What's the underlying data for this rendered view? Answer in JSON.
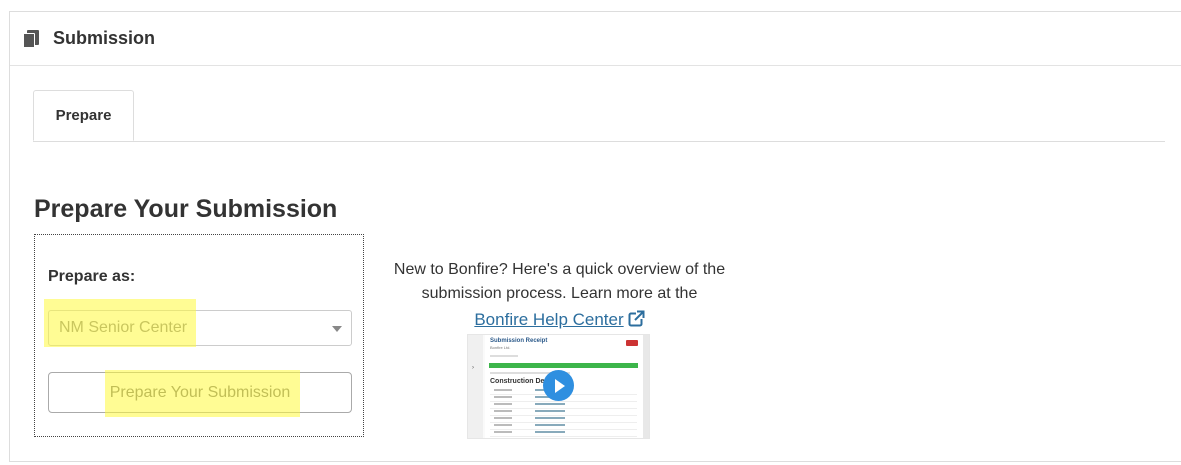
{
  "panel": {
    "title": "Submission",
    "icon": "document-icon"
  },
  "tabs": [
    {
      "label": "Prepare",
      "active": true
    }
  ],
  "main": {
    "heading": "Prepare Your Submission",
    "prepare_as_label": "Prepare as:",
    "select": {
      "value": "NM Senior Center"
    },
    "submit_label": "Prepare Your Submission",
    "info_text": "New to Bonfire? Here's a quick overview of the submission process. Learn more at the",
    "help_link": "Bonfire Help Center",
    "video_thumbnail": {
      "title": "Submission Receipt",
      "subtitle": "Bonfire Ltd.",
      "heading": "Construction Details"
    }
  },
  "colors": {
    "highlight": "#fffa3c",
    "link": "#2c6e9e",
    "play_button": "#2f8fe0",
    "progress_bar": "#3cb54a"
  }
}
